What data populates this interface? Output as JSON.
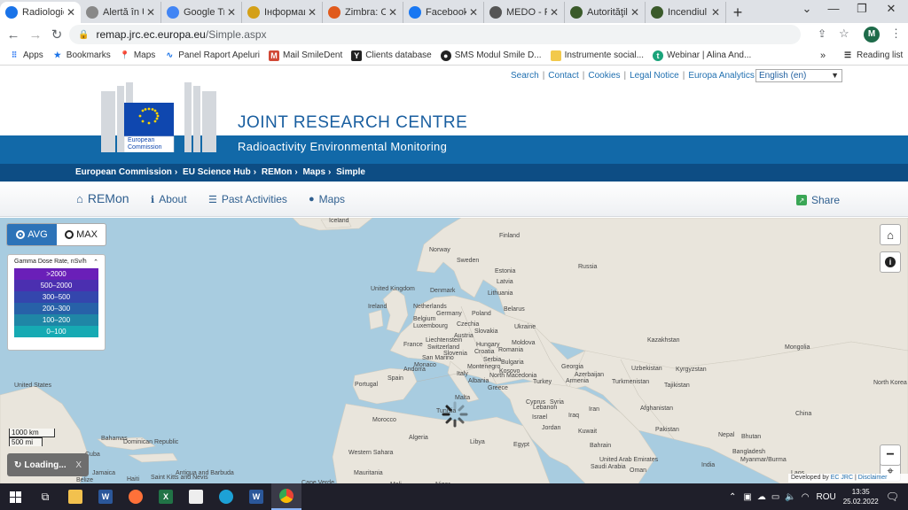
{
  "browser": {
    "tabs": [
      {
        "title": "Radiologic",
        "icon": "#1a73e8"
      },
      {
        "title": "Alertă în U",
        "icon": "#888"
      },
      {
        "title": "Google Tra",
        "icon": "#4285f4"
      },
      {
        "title": "Інформаці",
        "icon": "#d4a017"
      },
      {
        "title": "Zimbra: Co",
        "icon": "#e05a1c"
      },
      {
        "title": "Facebook",
        "icon": "#1877f2"
      },
      {
        "title": "MEDO - Pi",
        "icon": "#555"
      },
      {
        "title": "Autorităţil",
        "icon": "#3a5a2a"
      },
      {
        "title": "Incendiul",
        "icon": "#3a5a2a"
      }
    ],
    "new_tab": "+",
    "url_host": "remap.jrc.ec.europa.eu",
    "url_path": "/Simple.aspx",
    "profile": "M",
    "bookmarks": [
      "Apps",
      "Bookmarks",
      "Maps",
      "Panel Raport Apeluri",
      "Mail SmileDent",
      "Clients database",
      "SMS Modul Smile D...",
      "Instrumente social...",
      "Webinar | Alina And..."
    ],
    "reading_list": "Reading list"
  },
  "header": {
    "toplinks": [
      "Search",
      "Contact",
      "Cookies",
      "Legal Notice",
      "Europa Analytics"
    ],
    "language": "English (en)",
    "logo_text": "European Commission",
    "site_title": "JOINT RESEARCH CENTRE",
    "subtitle": "Radioactivity Environmental Monitoring",
    "breadcrumb": [
      "European Commission",
      "EU Science Hub",
      "REMon",
      "Maps",
      "Simple"
    ]
  },
  "nav": {
    "home": "REMon",
    "about": "About",
    "past": "Past Activities",
    "maps": "Maps",
    "share": "Share"
  },
  "map": {
    "avg": "AVG",
    "max": "MAX",
    "legend_title": "Gamma Dose Rate, nSv/h",
    "legend": [
      {
        "label": ">2000",
        "color": "#6a1fb8"
      },
      {
        "label": "500–2000",
        "color": "#4b2fb0"
      },
      {
        "label": "300–500",
        "color": "#3446ad"
      },
      {
        "label": "200–300",
        "color": "#2761a8"
      },
      {
        "label": "100–200",
        "color": "#1f86a6"
      },
      {
        "label": "0–100",
        "color": "#16aab3"
      }
    ],
    "scale_km": "1000 km",
    "scale_mi": "500 mi",
    "loading": "Loading...",
    "loading_close": "X",
    "credit_prefix": "Developed by",
    "credit_org": "EC JRC",
    "credit_sep": "|",
    "credit_link": "Disclaimer",
    "labels": [
      "Iceland",
      "Finland",
      "Norway",
      "Sweden",
      "Estonia",
      "Russia",
      "Latvia",
      "United Kingdom",
      "Denmark",
      "Lithuania",
      "Ireland",
      "Netherlands",
      "Belarus",
      "Germany",
      "Poland",
      "Belgium",
      "Luxembourg",
      "Czechia",
      "Ukraine",
      "Slovakia",
      "Austria",
      "Liechtenstein",
      "Switzerland",
      "Hungary",
      "Moldova",
      "France",
      "Slovenia",
      "Croatia",
      "Romania",
      "San Marino",
      "Monaco",
      "Serbia",
      "Andorra",
      "Bulgaria",
      "Montenegro",
      "Kosovo",
      "Kazakhstan",
      "Mongolia",
      "Italy",
      "Georgia",
      "Uzbekistan",
      "Kyrgyzstan",
      "Portugal",
      "Spain",
      "Albania",
      "North Macedonia",
      "Azerbaijan",
      "Armenia",
      "Turkey",
      "Turkmenistan",
      "Tajikistan",
      "Greece",
      "United States",
      "North Korea",
      "Malta",
      "Cyprus",
      "Syria",
      "Tunisia",
      "Lebanon",
      "Iraq",
      "Iran",
      "Afghanistan",
      "China",
      "Israel",
      "Morocco",
      "Jordan",
      "Kuwait",
      "Pakistan",
      "Algeria",
      "Libya",
      "Egypt",
      "Nepal",
      "Bhutan",
      "Bahrain",
      "Western Sahara",
      "Bangladesh",
      "Bahamas",
      "Dominican Republic",
      "Saudi Arabia",
      "United Arab Emirates",
      "Myanmar/Burma",
      "Cuba",
      "Mauritania",
      "Oman",
      "India",
      "Laos",
      "Antigua and Barbuda",
      "Saint Kitts and Nevis",
      "Jamaica",
      "Haiti",
      "Belize",
      "Mali",
      "Niger",
      "Cape Verde"
    ]
  },
  "taskbar": {
    "lang": "ROU",
    "time": "13:35",
    "date": "25.02.2022"
  }
}
